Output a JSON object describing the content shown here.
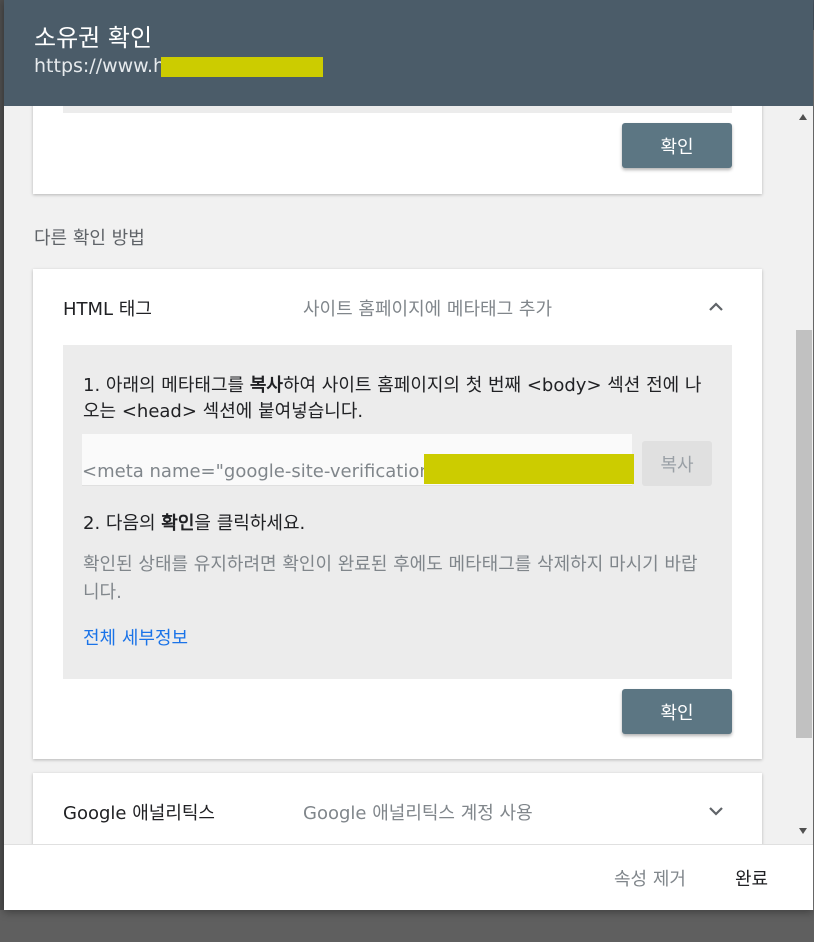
{
  "header": {
    "title": "소유권 확인",
    "url": "https://www.h"
  },
  "verify_card_top": {
    "confirm_label": "확인"
  },
  "other_methods_label": "다른 확인 방법",
  "html_tag": {
    "title": "HTML 태그",
    "description": "사이트 홈페이지에 메타태그 추가",
    "step1_prefix": "1. 아래의 메타태그를 ",
    "step1_bold": "복사",
    "step1_suffix": "하여 사이트 홈페이지의 첫 번째 <body> 섹션 전에 나오는 <head> 섹션에 붙여넣습니다.",
    "meta_tag": "<meta name=\"google-site-verification\"",
    "copy_label": "복사",
    "step2_prefix": "2. 다음의 ",
    "step2_bold": "확인",
    "step2_suffix": "을 클릭하세요.",
    "note": "확인된 상태를 유지하려면 확인이 완료된 후에도 메타태그를 삭제하지 마시기 바랍니다.",
    "details_link": "전체 세부정보",
    "confirm_label": "확인"
  },
  "google_analytics": {
    "title": "Google 애널리틱스",
    "description": "Google 애널리틱스 계정 사용"
  },
  "footer": {
    "remove_label": "속성 제거",
    "done_label": "완료"
  },
  "icons": {
    "expand_less": "chevron-up-icon",
    "expand_more": "chevron-down-icon"
  },
  "colors": {
    "header_bg": "#4b5c69",
    "primary_button": "#5c7683",
    "link": "#1a73e8",
    "redaction": "#cccc00"
  }
}
